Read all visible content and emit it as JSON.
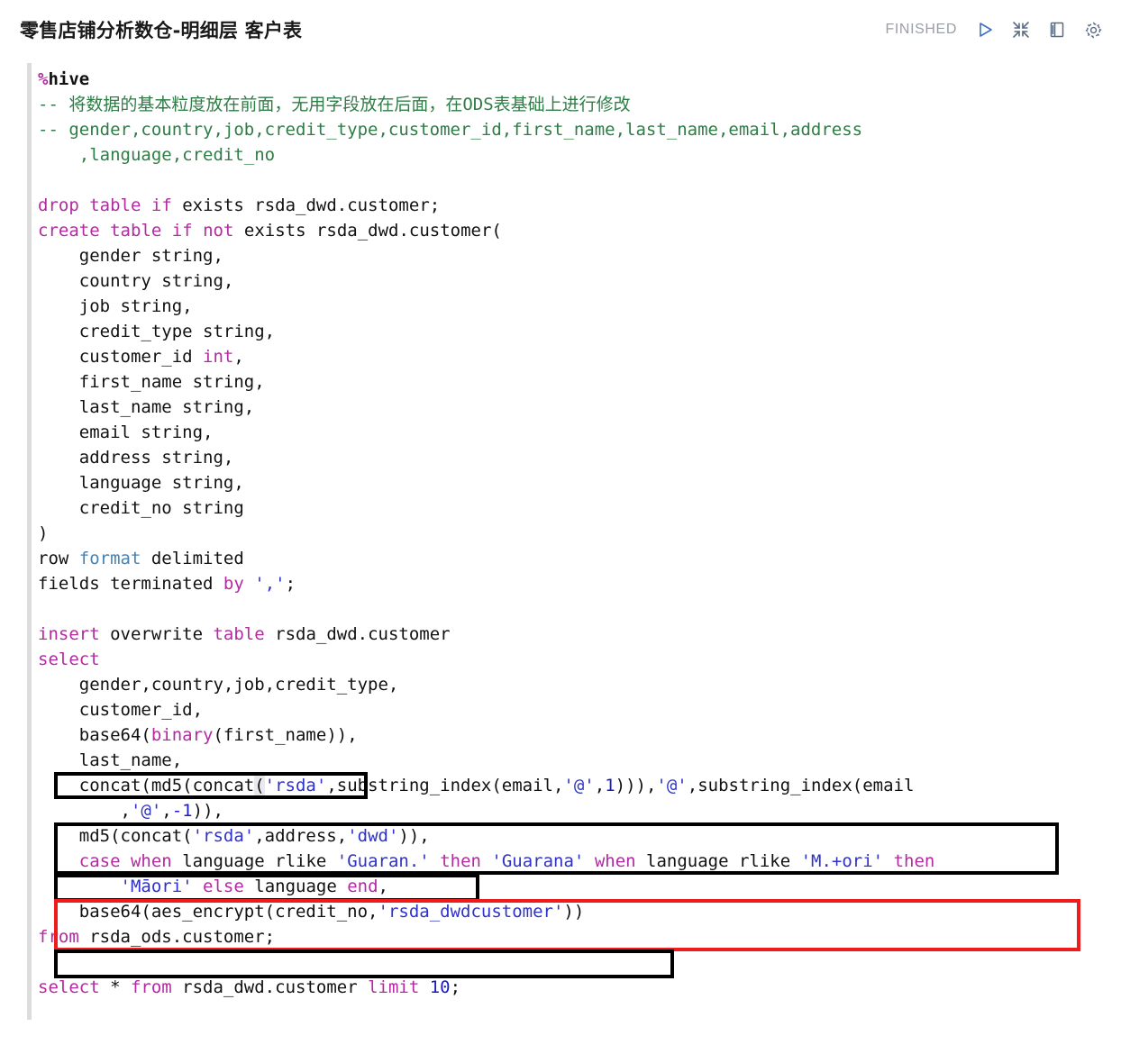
{
  "header": {
    "title": "零售店铺分析数仓-明细层 客户表",
    "status": "FINISHED",
    "icons": {
      "run": "play-icon",
      "collapse": "collapse-arrows-icon",
      "book": "book-panel-icon",
      "settings": "gear-icon"
    }
  },
  "editor": {
    "interpreter": "%hive",
    "language": "hive-sql",
    "lines": [
      "%hive",
      "-- 将数据的基本粒度放在前面，无用字段放在后面，在ODS表基础上进行修改",
      "-- gender,country,job,credit_type,customer_id,first_name,last_name,email,address",
      "    ,language,credit_no",
      "",
      "drop table if exists rsda_dwd.customer;",
      "create table if not exists rsda_dwd.customer(",
      "    gender string,",
      "    country string,",
      "    job string,",
      "    credit_type string,",
      "    customer_id int,",
      "    first_name string,",
      "    last_name string,",
      "    email string,",
      "    address string,",
      "    language string,",
      "    credit_no string",
      ")",
      "row format delimited",
      "fields terminated by ',';",
      "",
      "insert overwrite table rsda_dwd.customer",
      "select",
      "    gender,country,job,credit_type,",
      "    customer_id,",
      "    base64(binary(first_name)),",
      "    last_name,",
      "    concat(md5(concat('rsda',substring_index(email,'@',1))),'@',substring_index(email",
      "        ,'@',-1)),",
      "    md5(concat('rsda',address,'dwd')),",
      "    case when language rlike 'Guaran.' then 'Guarana' when language rlike 'M.+ori' then",
      "        'Māori' else language end,",
      "    base64(aes_encrypt(credit_no,'rsda_dwdcustomer'))",
      "from rsda_ods.customer;",
      "",
      "select * from rsda_dwd.customer limit 10;"
    ],
    "annotations": [
      {
        "name": "highlight-base64-binary-first-name",
        "color": "#000000",
        "target": "base64(binary(first_name))"
      },
      {
        "name": "highlight-email-md5-concat",
        "color": "#000000",
        "target": "concat(md5(concat('rsda',substring_index(email,'@',1))),'@',substring_index(email,'@',-1))"
      },
      {
        "name": "highlight-md5-address",
        "color": "#000000",
        "target": "md5(concat('rsda',address,'dwd'))"
      },
      {
        "name": "highlight-case-language",
        "color": "#ee1c1c",
        "target": "case when language rlike 'Guaran.' then 'Guarana' when language rlike 'M.+ori' then 'Māori' else language end"
      },
      {
        "name": "highlight-base64-aes-encrypt",
        "color": "#000000",
        "target": "base64(aes_encrypt(credit_no,'rsda_dwdcustomer'))"
      }
    ]
  },
  "tokens": {
    "keyword_color": "#b32ba0",
    "string_color": "#2f32c8",
    "comment_color": "#2e7d46",
    "number_color": "#1b1bc4",
    "secondary_keyword_color": "#4682b4",
    "identifier_color": "#111111"
  }
}
